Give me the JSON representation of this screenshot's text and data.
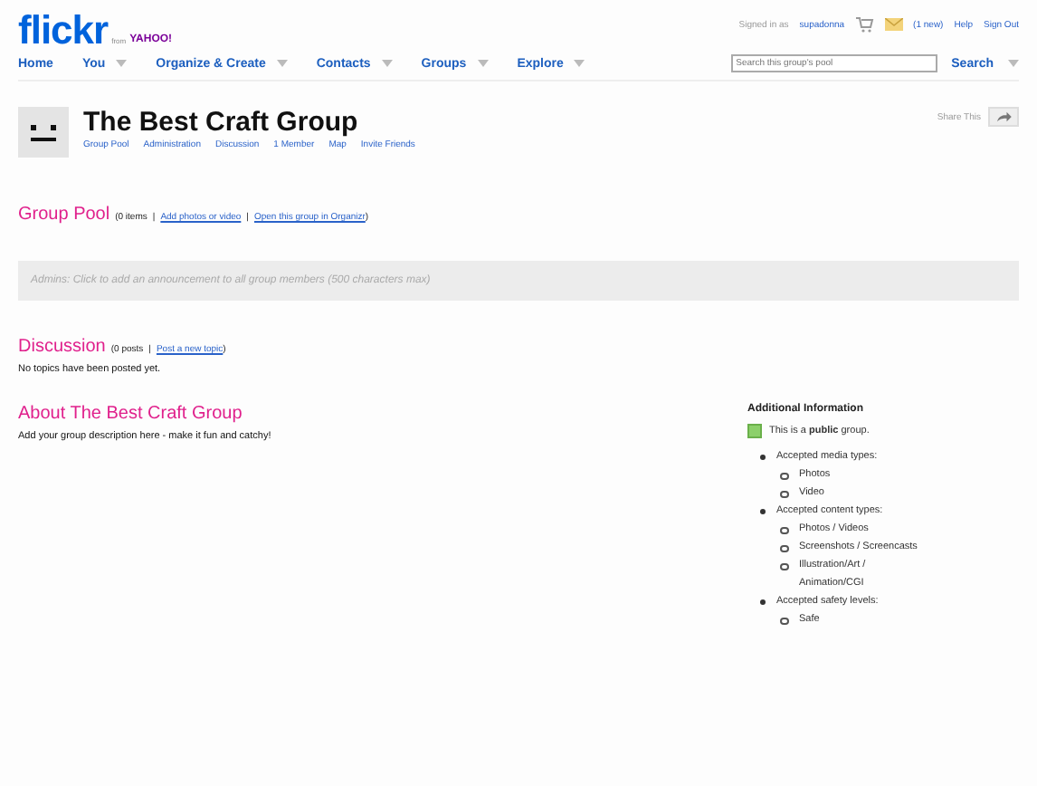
{
  "logo": {
    "main": "flickr",
    "sub": "from",
    "brand": "YAHOO!"
  },
  "account": {
    "signed_in_label": "Signed in as",
    "user": "supadonna",
    "mail": "(1 new)",
    "links": [
      "Help",
      "Sign Out"
    ]
  },
  "nav": [
    {
      "label": "Home",
      "dropdown": false
    },
    {
      "label": "You",
      "dropdown": true
    },
    {
      "label": "Organize & Create",
      "dropdown": true
    },
    {
      "label": "Contacts",
      "dropdown": true
    },
    {
      "label": "Groups",
      "dropdown": true
    },
    {
      "label": "Explore",
      "dropdown": true
    }
  ],
  "search": {
    "placeholder": "Search this group's pool",
    "button": "Search"
  },
  "group": {
    "title": "The Best Craft Group",
    "share": "Share This",
    "links": [
      "Group Pool",
      "Administration",
      "Discussion",
      "1 Member",
      "Map",
      "Invite Friends"
    ]
  },
  "pool": {
    "heading": "Group Pool",
    "count": "(0 items",
    "separator": "|",
    "links": [
      "Add photos or video",
      "Open this group in Organizr"
    ],
    "close": ")"
  },
  "announcement": "Admins: Click to add an announcement to all group members (500 characters max)",
  "discussion": {
    "heading": "Discussion",
    "count": "(0 posts",
    "separator": "|",
    "links": [
      "Post a new topic"
    ],
    "close": ")",
    "empty": "No topics have been posted yet."
  },
  "about": {
    "heading": "About The Best Craft Group",
    "text": "Add your group description here - make it fun and catchy!"
  },
  "info": {
    "heading": "Additional Information",
    "public_note": "This is a **public** group.",
    "items": [
      {
        "label": "Accepted media types:",
        "children": [
          {
            "label": "Photos"
          },
          {
            "label": "Video"
          }
        ]
      },
      {
        "label": "Accepted content types:",
        "children": [
          {
            "label": "Photos / Videos"
          },
          {
            "label": "Screenshots / Screencasts"
          },
          {
            "label": "Illustration/Art / Animation/CGI"
          }
        ]
      },
      {
        "label": "Accepted safety levels:",
        "children": [
          {
            "label": "Safe"
          }
        ]
      }
    ]
  }
}
